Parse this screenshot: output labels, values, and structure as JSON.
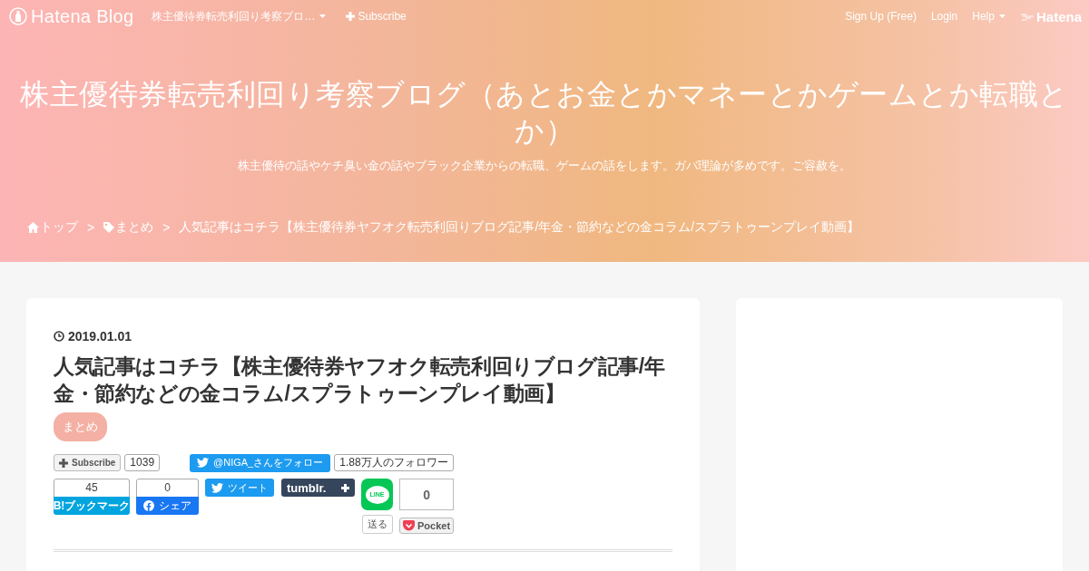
{
  "top_bar": {
    "logo": "Hatena Blog",
    "blog_menu": "株主優待券転売利回り考察ブロ…",
    "subscribe": "Subscribe",
    "links": [
      {
        "label": "Sign Up (Free)",
        "kind": "link"
      },
      {
        "label": "Login",
        "kind": "link"
      },
      {
        "label": "Help",
        "kind": "menu"
      }
    ],
    "brand": "Hatena"
  },
  "blog": {
    "title": "株主優待券転売利回り考察ブログ（あとお金とかマネーとかゲームとか転職とか）",
    "description": "株主優待の話やケチ臭い金の話やブラック企業からの転職、ゲームの話をします。ガバ理論が多めです。ご容赦を。"
  },
  "breadcrumbs": [
    {
      "label": "トップ",
      "kind": "home"
    },
    {
      "label": ">",
      "kind": "separator"
    },
    {
      "label": "まとめ",
      "kind": "tag"
    },
    {
      "label": ">",
      "kind": "separator"
    },
    {
      "label": "人気記事はコチラ【株主優待券ヤフオク転売利回りブログ記事/年金・節約などの金コラム/スプラトゥーンプレイ動画】",
      "kind": "current"
    }
  ],
  "article": {
    "date": "2019.01.01",
    "title": "人気記事はコチラ【株主優待券ヤフオク転売利回りブログ記事/年金・節約などの金コラム/スプラトゥーンプレイ動画】",
    "categories": [
      "まとめ"
    ],
    "share_row_1": {
      "subscribe": "Subscribe",
      "subscribers": "1039",
      "follow": "@NIGA_さんをフォロー",
      "followers": "1.88万人のフォロワー"
    },
    "share_row_2": {
      "hatena_count": "45",
      "hatena_label": "B!ブックマーク",
      "facebook_count": "0",
      "facebook_label": "シェア",
      "tweet": "ツイート",
      "tumblr": "tumblr.",
      "line_logo": "LINE",
      "line_label": "送る",
      "pocket_count": "0",
      "pocket_label": "Pocket"
    }
  }
}
